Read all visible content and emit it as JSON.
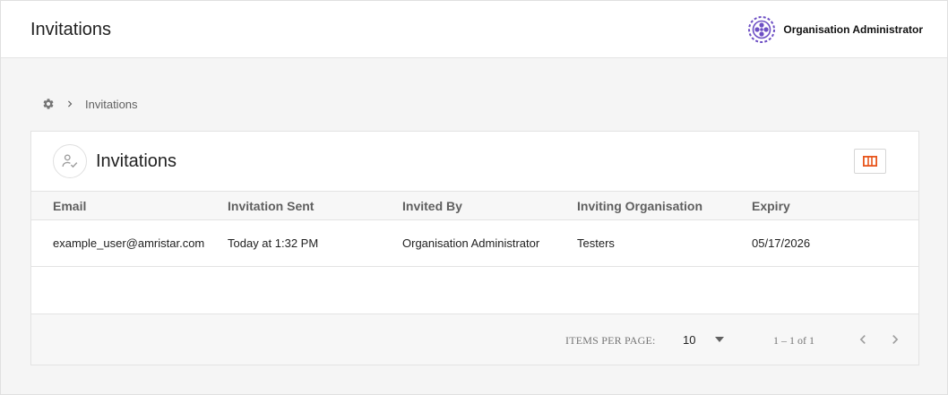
{
  "app": {
    "page_title": "Invitations"
  },
  "user": {
    "name": "Organisation Administrator",
    "avatar_icon": "org-logo-icon"
  },
  "breadcrumb": {
    "home_icon": "settings-gear-icon",
    "separator_icon": "chevron-right-icon",
    "current": "Invitations"
  },
  "card": {
    "title": "Invitations",
    "title_icon": "user-check-icon",
    "columns_button_icon": "columns-icon",
    "accent_color": "#e8561d"
  },
  "table": {
    "headers": [
      "Email",
      "Invitation Sent",
      "Invited By",
      "Inviting Organisation",
      "Expiry"
    ],
    "rows": [
      [
        "example_user@amristar.com",
        "Today at 1:32 PM",
        "Organisation Administrator",
        "Testers",
        "05/17/2026"
      ]
    ]
  },
  "pagination": {
    "items_per_page_label": "ITEMS PER PAGE:",
    "items_per_page_value": "10",
    "range_label": "1 – 1 of 1",
    "prev_icon": "chevron-left-icon",
    "next_icon": "chevron-right-icon"
  },
  "colors": {
    "brand_purple": "#6d4fc4",
    "accent_orange": "#e8561d"
  }
}
